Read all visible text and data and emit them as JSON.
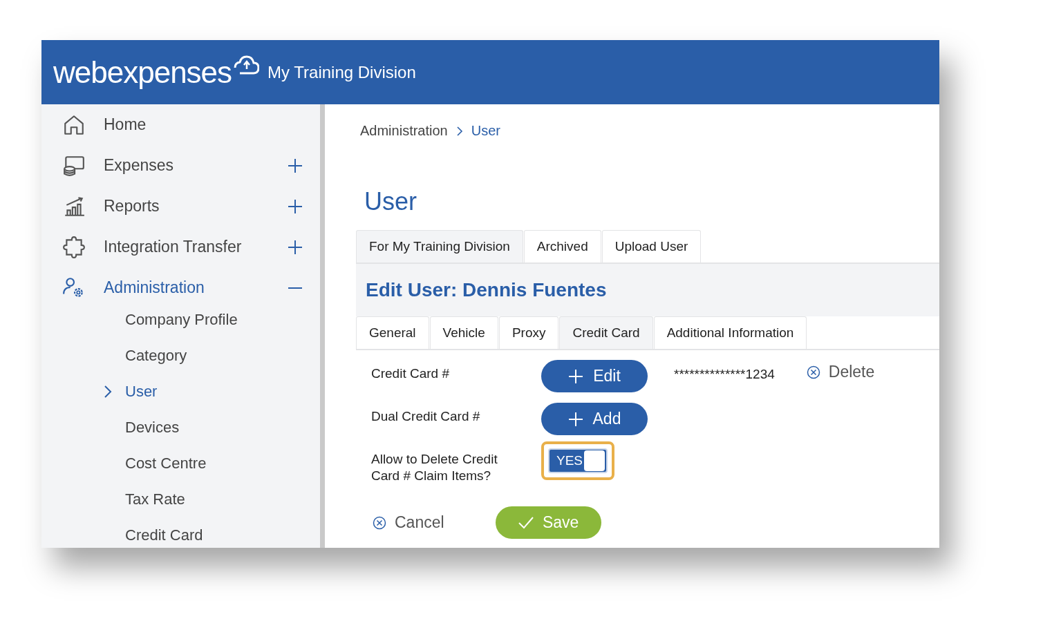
{
  "header": {
    "logo": "webexpenses",
    "division": "My Training Division"
  },
  "sidebar": {
    "items": [
      {
        "label": "Home",
        "kind": "link"
      },
      {
        "label": "Expenses",
        "kind": "group",
        "expanded": false
      },
      {
        "label": "Reports",
        "kind": "group",
        "expanded": false
      },
      {
        "label": "Integration Transfer",
        "kind": "group",
        "expanded": false
      },
      {
        "label": "Administration",
        "kind": "group",
        "expanded": true,
        "children": [
          {
            "label": "Company Profile",
            "selected": false
          },
          {
            "label": "Category",
            "selected": false
          },
          {
            "label": "User",
            "selected": true
          },
          {
            "label": "Devices",
            "selected": false
          },
          {
            "label": "Cost Centre",
            "selected": false
          },
          {
            "label": "Tax Rate",
            "selected": false
          },
          {
            "label": "Credit Card",
            "selected": false
          }
        ]
      }
    ]
  },
  "breadcrumb": [
    "Administration",
    "User"
  ],
  "page_title": "User",
  "tabs": [
    {
      "label": "For My Training Division",
      "selected": true
    },
    {
      "label": "Archived",
      "selected": false
    },
    {
      "label": "Upload User",
      "selected": false
    }
  ],
  "panel_title": "Edit User: Dennis Fuentes",
  "subtabs": [
    {
      "label": "General",
      "selected": false
    },
    {
      "label": "Vehicle",
      "selected": false
    },
    {
      "label": "Proxy",
      "selected": false
    },
    {
      "label": "Credit Card",
      "selected": true
    },
    {
      "label": "Additional Information",
      "selected": false
    }
  ],
  "form": {
    "rows": [
      {
        "kind": "button",
        "label": "Credit Card #",
        "button": "Edit",
        "value": "**************1234",
        "action": "Delete"
      },
      {
        "kind": "button",
        "label": "Dual Credit Card #",
        "button": "Add"
      },
      {
        "kind": "toggle",
        "label": "Allow to Delete Credit Card # Claim Items?",
        "toggle": "YES",
        "on": true,
        "highlighted": true
      }
    ]
  },
  "actions": {
    "cancel": "Cancel",
    "save": "Save"
  }
}
